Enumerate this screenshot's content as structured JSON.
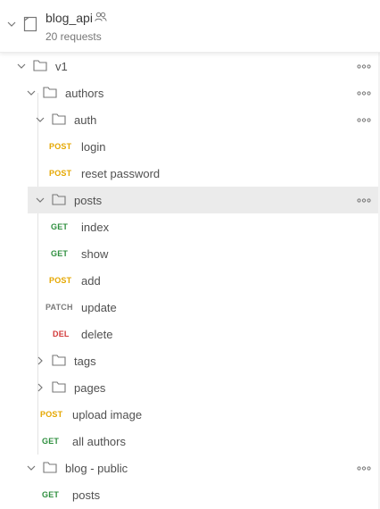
{
  "collection": {
    "name": "blog_api",
    "request_count": "20 requests",
    "icons": {
      "expand": "chevron-down-icon",
      "collection": "collection-icon",
      "shared": "users-icon"
    }
  },
  "tree": {
    "v1": {
      "label": "v1"
    },
    "authors": {
      "label": "authors"
    },
    "auth": {
      "label": "auth",
      "requests": [
        {
          "method": "POST",
          "name": "login"
        },
        {
          "method": "POST",
          "name": "reset password"
        }
      ]
    },
    "posts": {
      "label": "posts",
      "requests": [
        {
          "method": "GET",
          "name": "index"
        },
        {
          "method": "GET",
          "name": "show"
        },
        {
          "method": "POST",
          "name": "add"
        },
        {
          "method": "PATCH",
          "name": "update"
        },
        {
          "method": "DEL",
          "name": "delete"
        }
      ]
    },
    "tags": {
      "label": "tags"
    },
    "pages": {
      "label": "pages"
    },
    "authors_requests": [
      {
        "method": "POST",
        "name": "upload image"
      },
      {
        "method": "GET",
        "name": "all authors"
      }
    ],
    "blog_public": {
      "label": "blog - public",
      "requests": [
        {
          "method": "GET",
          "name": "posts"
        }
      ]
    }
  },
  "colors": {
    "post": "#e5a700",
    "get": "#2f8f3f",
    "patch": "#7a7a7a",
    "del": "#d23a3a",
    "selected_bg": "#ebebeb"
  }
}
